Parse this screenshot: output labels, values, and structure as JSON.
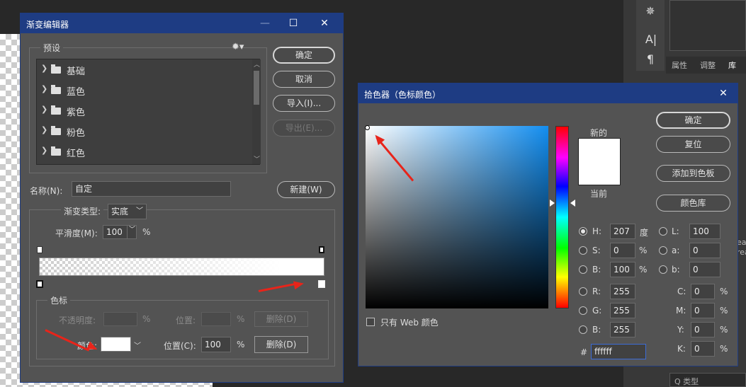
{
  "tool_icons": [
    "ship-wheel-icon",
    "text-cursor-icon",
    "paragraph-icon"
  ],
  "right_tabs": [
    "属性",
    "调整",
    "库"
  ],
  "right_bottom_label": "Q 类型",
  "right_edge_text": [
    "eat",
    "rea"
  ],
  "gradient_editor": {
    "title": "渐变编辑器",
    "presets_label": "预设",
    "presets": [
      "基础",
      "蓝色",
      "紫色",
      "粉色",
      "红色"
    ],
    "buttons": {
      "ok": "确定",
      "cancel": "取消",
      "import": "导入(I)...",
      "export": "导出(E)...",
      "new": "新建(W)"
    },
    "name_label": "名称(N):",
    "name_value": "自定",
    "gradient_type_label": "渐变类型:",
    "gradient_type_value": "实底",
    "smoothness_label": "平滑度(M):",
    "smoothness_value": "100",
    "percent": "%",
    "stops_group": "色标",
    "opacity_label": "不透明度:",
    "location_label_disabled": "位置:",
    "delete_label_disabled": "删除(D)",
    "color_label": "颜色:",
    "location_label": "位置(C):",
    "location_value": "100",
    "delete_label": "删除(D)"
  },
  "color_picker": {
    "title": "拾色器（色标颜色）",
    "new_label": "新的",
    "current_label": "当前",
    "web_only_label": "只有 Web 颜色",
    "buttons": {
      "ok": "确定",
      "reset": "复位",
      "add_swatch": "添加到色板",
      "libraries": "颜色库"
    },
    "hsb": [
      {
        "label": "H:",
        "value": "207",
        "unit": "度"
      },
      {
        "label": "S:",
        "value": "0",
        "unit": "%"
      },
      {
        "label": "B:",
        "value": "100",
        "unit": "%"
      }
    ],
    "rgb": [
      {
        "label": "R:",
        "value": "255"
      },
      {
        "label": "G:",
        "value": "255"
      },
      {
        "label": "B:",
        "value": "255"
      }
    ],
    "lab": [
      {
        "label": "L:",
        "value": "100"
      },
      {
        "label": "a:",
        "value": "0"
      },
      {
        "label": "b:",
        "value": "0"
      }
    ],
    "cmyk": [
      {
        "label": "C:",
        "value": "0",
        "unit": "%"
      },
      {
        "label": "M:",
        "value": "0",
        "unit": "%"
      },
      {
        "label": "Y:",
        "value": "0",
        "unit": "%"
      },
      {
        "label": "K:",
        "value": "0",
        "unit": "%"
      }
    ],
    "hash": "#",
    "hex": "ffffff"
  },
  "colors": {
    "title_bar": "#1e3c83",
    "annotation_arrow": "#e8241a",
    "selected_color": "#ffffff"
  }
}
